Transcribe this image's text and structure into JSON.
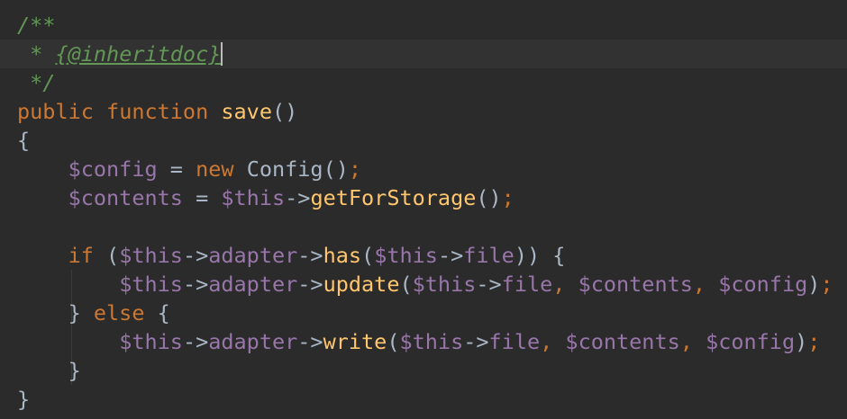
{
  "colors": {
    "background": "#2b2b2b",
    "current_line": "#323232",
    "doc_comment": "#629755",
    "keyword": "#cc7832",
    "function": "#ffc66d",
    "variable": "#9876aa",
    "text": "#a9b7c6"
  },
  "code": {
    "l1": {
      "t1": "/**"
    },
    "l2": {
      "t1": " * ",
      "t2": "{@inheritdoc}"
    },
    "l3": {
      "t1": " */"
    },
    "l4": {
      "t1": "public",
      "t2": " ",
      "t3": "function",
      "t4": " ",
      "t5": "save",
      "t6": "()"
    },
    "l5": {
      "t1": "{"
    },
    "l6": {
      "t1": "    ",
      "t2": "$config",
      "t3": " = ",
      "t4": "new",
      "t5": " Config()",
      "t6": ";"
    },
    "l7": {
      "t1": "    ",
      "t2": "$contents",
      "t3": " = ",
      "t4": "$this",
      "t5": "->",
      "t6": "getForStorage",
      "t7": "()",
      "t8": ";"
    },
    "l9": {
      "t1": "    ",
      "t2": "if",
      "t3": " (",
      "t4": "$this",
      "t5": "->",
      "t6": "adapter",
      "t7": "->",
      "t8": "has",
      "t9": "(",
      "t10": "$this",
      "t11": "->",
      "t12": "file",
      "t13": ")) {"
    },
    "l10": {
      "t1": "        ",
      "t2": "$this",
      "t3": "->",
      "t4": "adapter",
      "t5": "->",
      "t6": "update",
      "t7": "(",
      "t8": "$this",
      "t9": "->",
      "t10": "file",
      "t11": ", ",
      "t12": "$contents",
      "t13": ", ",
      "t14": "$config",
      "t15": ")",
      "t16": ";"
    },
    "l11": {
      "t1": "    } ",
      "t2": "else",
      "t3": " {"
    },
    "l12": {
      "t1": "        ",
      "t2": "$this",
      "t3": "->",
      "t4": "adapter",
      "t5": "->",
      "t6": "write",
      "t7": "(",
      "t8": "$this",
      "t9": "->",
      "t10": "file",
      "t11": ", ",
      "t12": "$contents",
      "t13": ", ",
      "t14": "$config",
      "t15": ")",
      "t16": ";"
    },
    "l13": {
      "t1": "    }"
    },
    "l14": {
      "t1": "}"
    }
  }
}
